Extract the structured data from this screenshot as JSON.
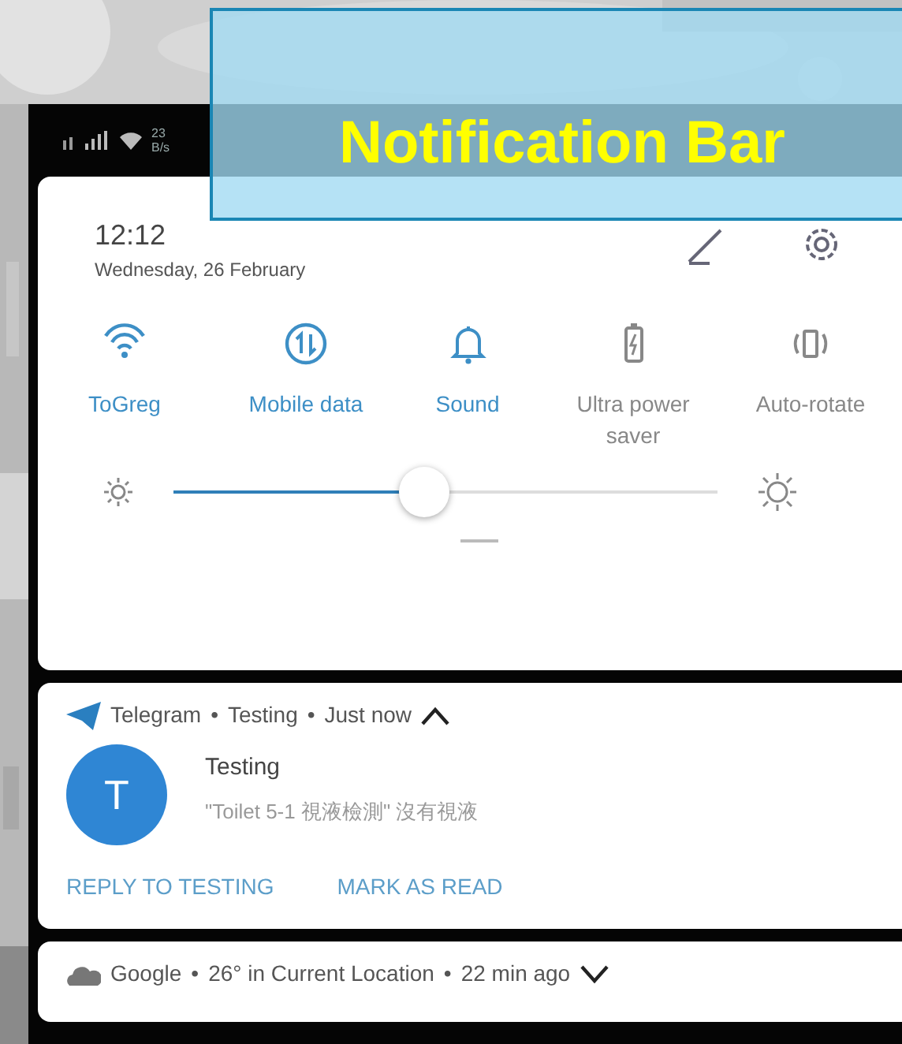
{
  "status_bar": {
    "net_speed": [
      "23",
      "B/s"
    ]
  },
  "header": {
    "time": "12:12",
    "date": "Wednesday, 26 February"
  },
  "tiles": [
    {
      "label": "ToGreg",
      "kind": "wifi",
      "selected": true
    },
    {
      "label": "Mobile data",
      "kind": "data",
      "selected": true
    },
    {
      "label": "Sound",
      "kind": "bell",
      "selected": true
    },
    {
      "label": "Ultra power saver",
      "kind": "battery",
      "selected": false
    },
    {
      "label": "Auto-rotate",
      "kind": "rotate",
      "selected": false
    }
  ],
  "brightness": {
    "level": 0.46
  },
  "notifications": [
    {
      "kind": "message",
      "app": "Telegram",
      "sep1": "•",
      "channel": "Testing",
      "sep2": "•",
      "time": "Just now",
      "expanded": true,
      "avatar": "T",
      "title": "Testing",
      "text": "\"Toilet 5-1 視液檢測\" 沒有視液",
      "actions": [
        "REPLY TO TESTING",
        "MARK AS READ"
      ]
    },
    {
      "kind": "weather",
      "app": "Google",
      "sep1": "•",
      "channel": "26° in Current Location",
      "sep2": "•",
      "time": "22 min ago",
      "expanded": false
    }
  ],
  "annotation": {
    "label": "Notification Bar"
  }
}
